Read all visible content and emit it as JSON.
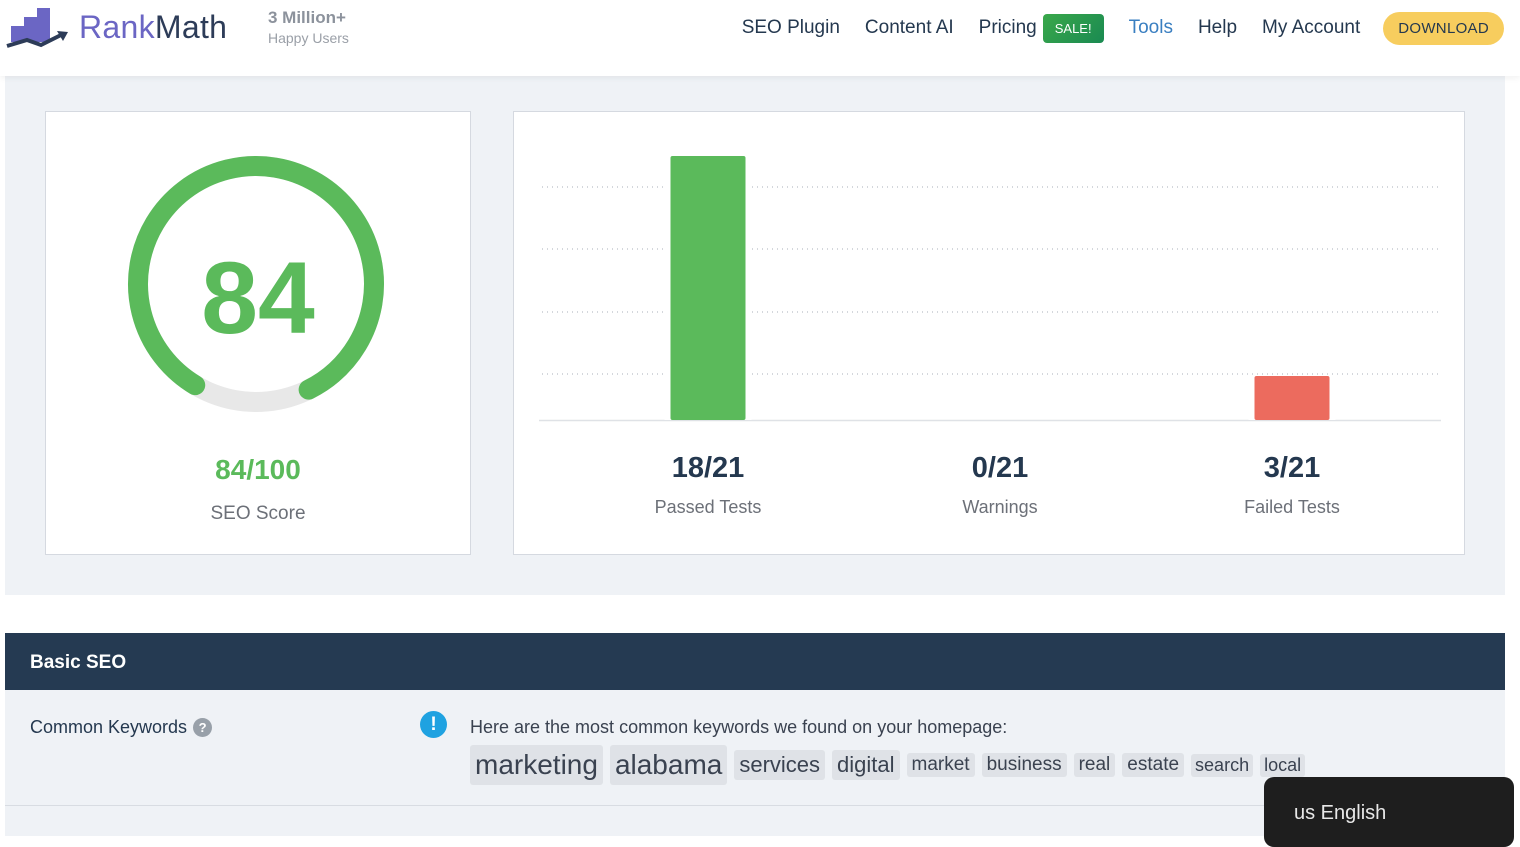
{
  "header": {
    "brand_rank": "Rank",
    "brand_math": "Math",
    "tagline_big": "3 Million+",
    "tagline_small": "Happy Users",
    "nav": {
      "seo_plugin": "SEO Plugin",
      "content_ai": "Content AI",
      "pricing": "Pricing",
      "sale_badge": "SALE!",
      "tools": "Tools",
      "help": "Help",
      "my_account": "My Account",
      "download": "DOWNLOAD"
    },
    "active_nav": "Tools"
  },
  "score": {
    "value": "84",
    "fraction": "84/100",
    "label": "SEO Score",
    "percent": 84,
    "color": "#5bba5b",
    "track_color": "#e8e8e8"
  },
  "chart_data": {
    "type": "bar",
    "title": "",
    "categories": [
      "Passed Tests",
      "Warnings",
      "Failed Tests"
    ],
    "values": [
      18,
      0,
      3
    ],
    "total": 21,
    "colors": [
      "#5bba5b",
      "#f0b849",
      "#ec6b5e"
    ],
    "ylim": [
      0,
      21
    ],
    "grid": true,
    "xlabel": "",
    "ylabel": ""
  },
  "stats": [
    {
      "value": "18/21",
      "label": "Passed Tests"
    },
    {
      "value": "0/21",
      "label": "Warnings"
    },
    {
      "value": "3/21",
      "label": "Failed Tests"
    }
  ],
  "basic_seo": {
    "title": "Basic SEO",
    "common_keywords": {
      "label": "Common Keywords",
      "help_icon": "?",
      "info_icon": "!",
      "description": "Here are the most common keywords we found on your homepage:",
      "keywords": [
        {
          "word": "marketing",
          "weight": 5
        },
        {
          "word": "alabama",
          "weight": 5
        },
        {
          "word": "services",
          "weight": 4
        },
        {
          "word": "digital",
          "weight": 4
        },
        {
          "word": "market",
          "weight": 3
        },
        {
          "word": "business",
          "weight": 3
        },
        {
          "word": "real",
          "weight": 3
        },
        {
          "word": "estate",
          "weight": 3
        },
        {
          "word": "search",
          "weight": 2
        },
        {
          "word": "local",
          "weight": 2
        }
      ]
    }
  },
  "language_popup": {
    "label": "us English"
  }
}
